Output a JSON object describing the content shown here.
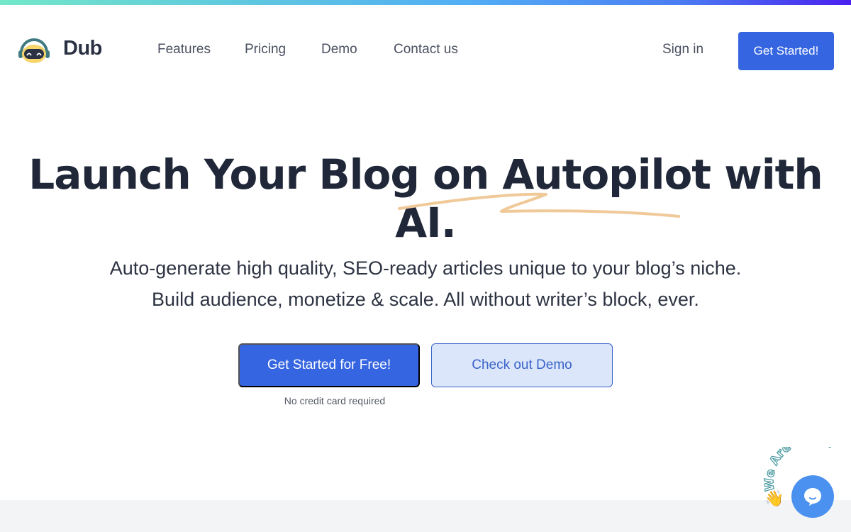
{
  "header": {
    "brand": "Dub",
    "nav": [
      {
        "label": "Features"
      },
      {
        "label": "Pricing"
      },
      {
        "label": "Demo"
      },
      {
        "label": "Contact us"
      }
    ],
    "sign_in": "Sign in",
    "cta": "Get Started!"
  },
  "hero": {
    "title": "Launch Your Blog on Autopilot with AI.",
    "subtitle_line1": "Auto-generate high quality, SEO-ready articles unique to your blog’s niche.",
    "subtitle_line2": "Build audience, monetize & scale. All without writer’s block, ever.",
    "primary_button": "Get Started for Free!",
    "secondary_button": "Check out Demo",
    "note": "No credit card required"
  },
  "chat_widget": {
    "label": "We Are Here!",
    "wave_emoji": "👋"
  },
  "colors": {
    "accent": "#3565e0",
    "accent_light": "#dbe6fb",
    "heading": "#1f2738",
    "underline": "#f0c998",
    "chat": "#4b91ef"
  }
}
